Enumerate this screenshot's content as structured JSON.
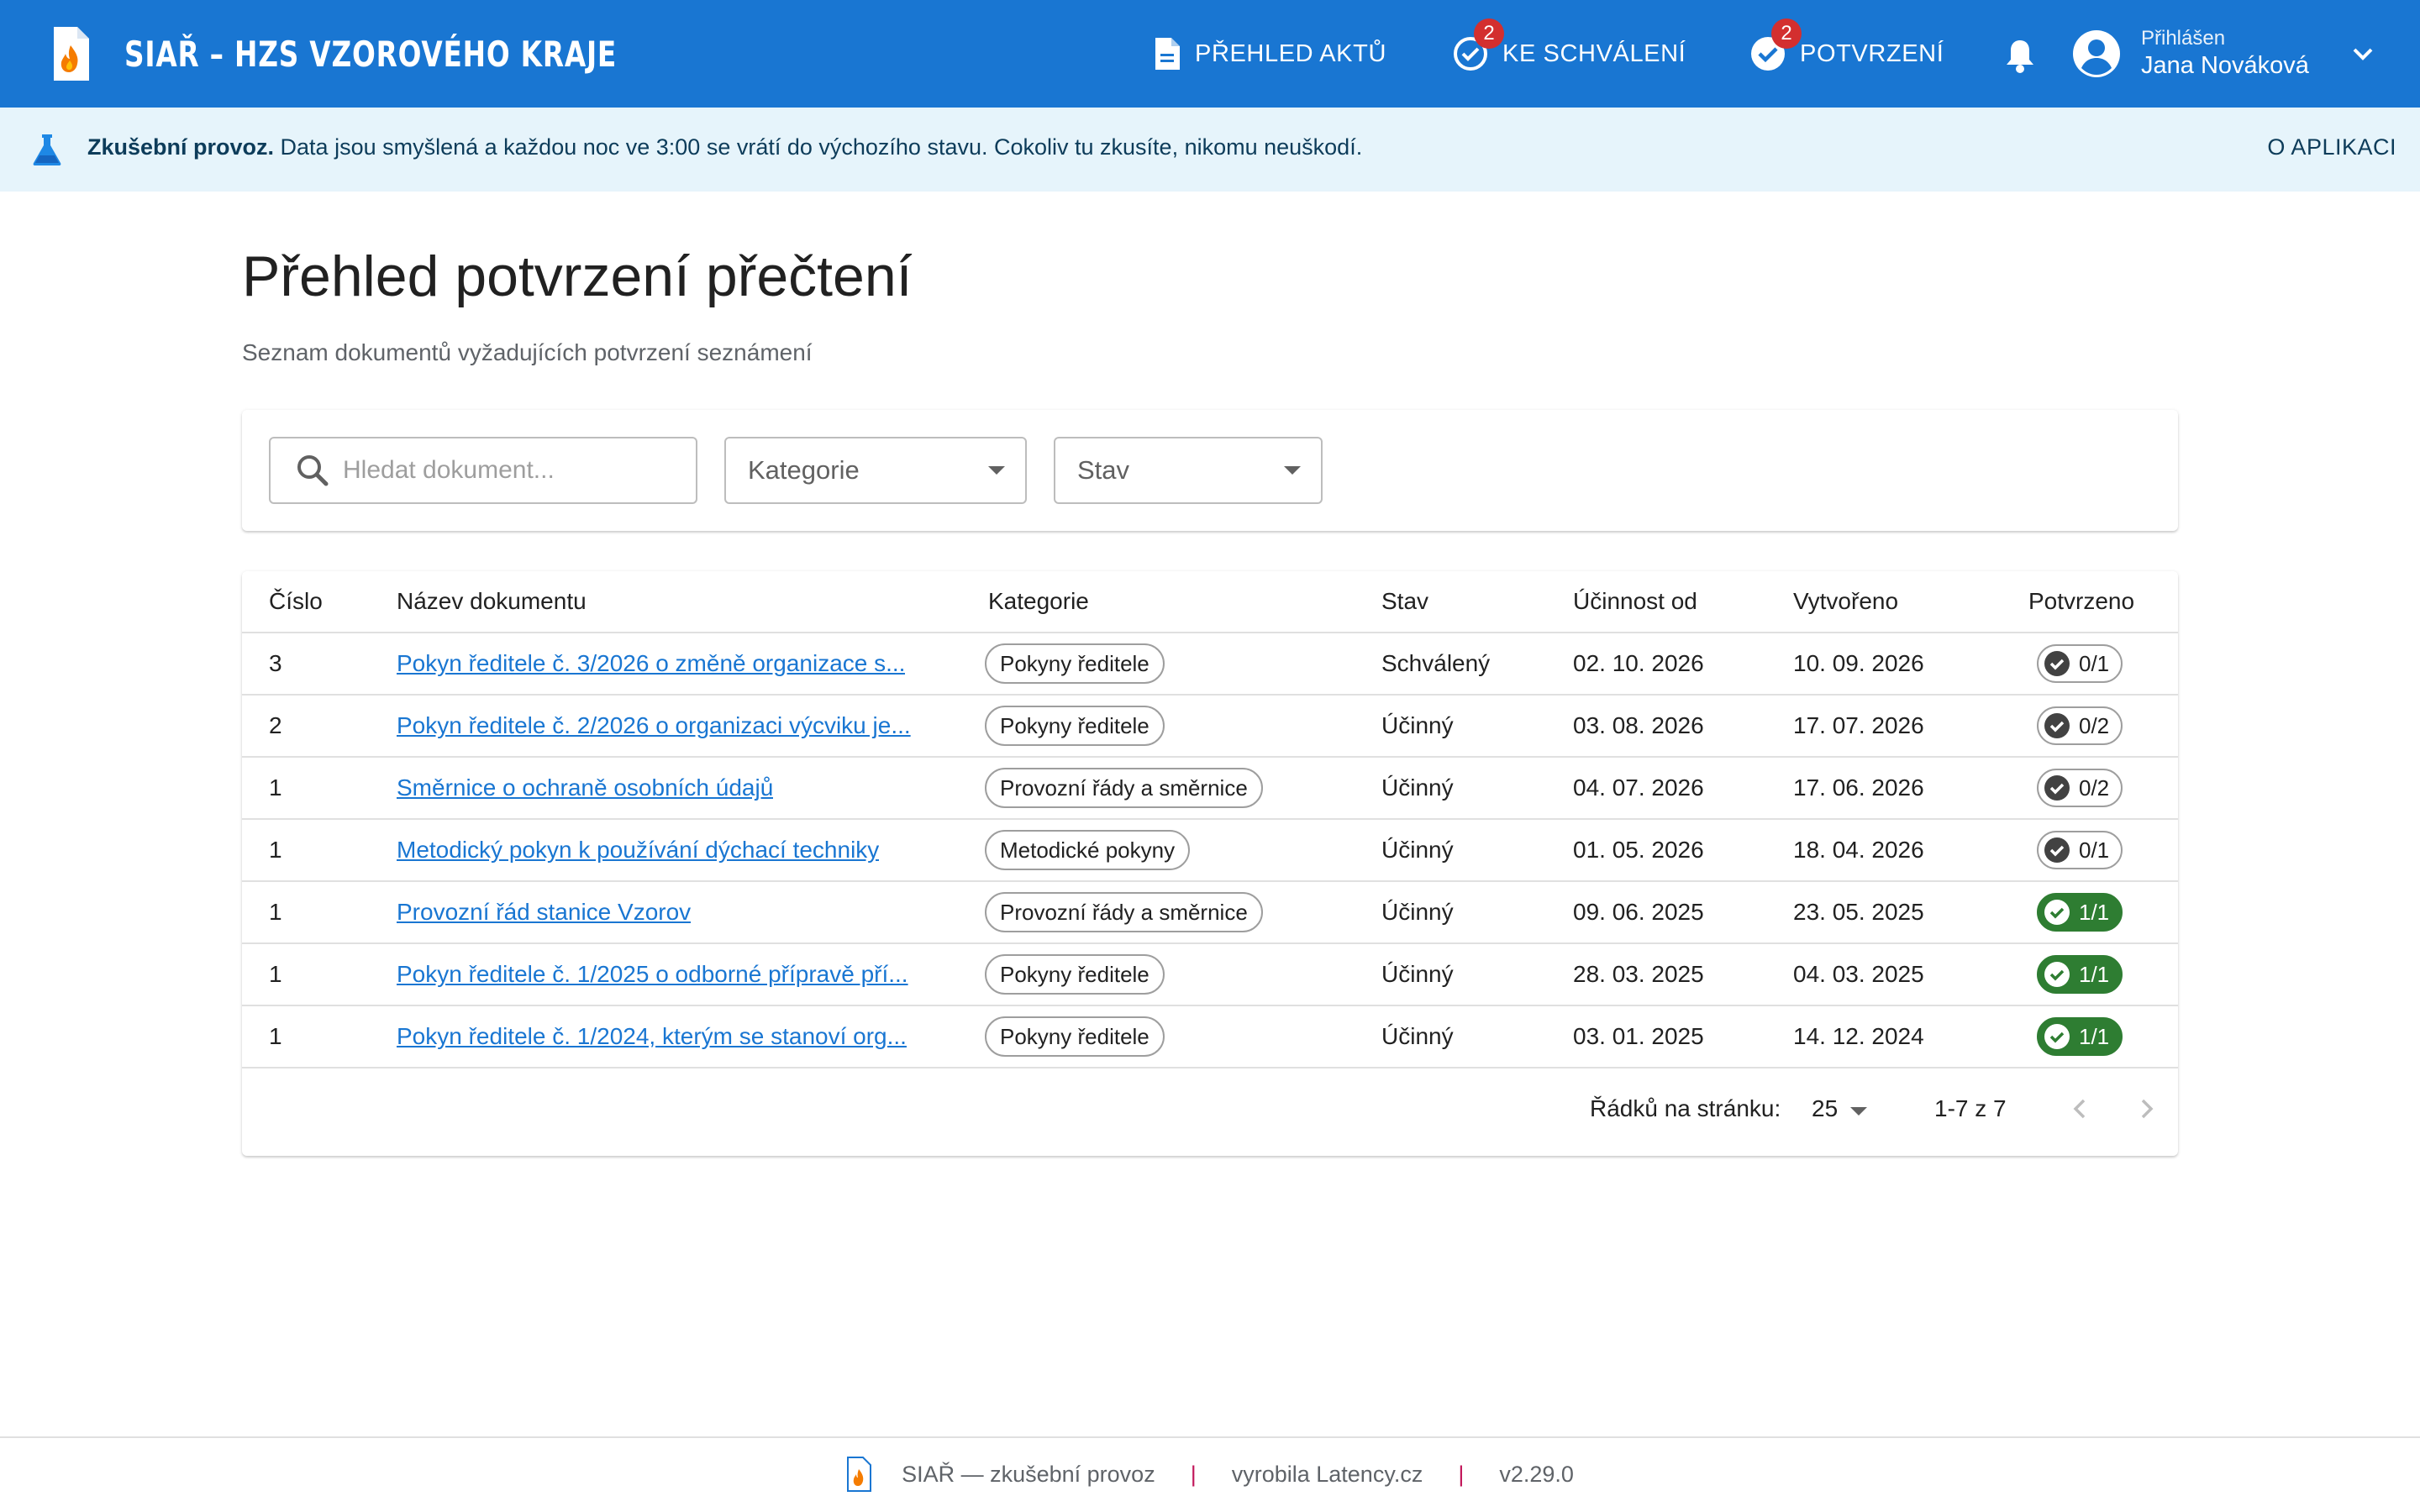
{
  "app": {
    "title": "SIAŘ – HZS VZOROVÉHO KRAJE",
    "accent_color": "#1976d2"
  },
  "nav": {
    "items": [
      {
        "label": "PŘEHLED AKTŮ",
        "icon": "document-icon",
        "badge": null
      },
      {
        "label": "KE SCHVÁLENÍ",
        "icon": "check-circle-outline-icon",
        "badge": "2"
      },
      {
        "label": "POTVRZENÍ",
        "icon": "check-circle-filled-icon",
        "badge": "2"
      }
    ],
    "notifications_icon": "bell-icon"
  },
  "user": {
    "caption": "Přihlášen",
    "name": "Jana Nováková",
    "avatar_icon": "account-circle-icon"
  },
  "banner": {
    "icon": "flask-icon",
    "bold": "Zkušební provoz.",
    "text": " Data jsou smyšlená a každou noc ve 3:00 se vrátí do výchozího stavu. Cokoliv tu zkusíte, nikomu neuškodí.",
    "link": "O APLIKACI",
    "background": "#e6f4fb"
  },
  "page": {
    "title": "Přehled potvrzení přečtení",
    "subtitle": "Seznam dokumentů vyžadujících potvrzení seznámení"
  },
  "filters": {
    "search_placeholder": "Hledat dokument...",
    "search_value": "",
    "category_label": "Kategorie",
    "state_label": "Stav"
  },
  "table": {
    "columns": [
      "Číslo",
      "Název dokumentu",
      "Kategorie",
      "Stav",
      "Účinnost od",
      "Vytvořeno",
      "Potvrzeno"
    ],
    "rows": [
      {
        "number": "3",
        "name": "Pokyn ředitele č. 3/2026 o změně organizace s...",
        "category": "Pokyny ředitele",
        "state": "Schválený",
        "effective": "02. 10. 2026",
        "created": "10. 09. 2026",
        "confirmed": "0/1",
        "done": false
      },
      {
        "number": "2",
        "name": "Pokyn ředitele č. 2/2026 o organizaci výcviku je...",
        "category": "Pokyny ředitele",
        "state": "Účinný",
        "effective": "03. 08. 2026",
        "created": "17. 07. 2026",
        "confirmed": "0/2",
        "done": false
      },
      {
        "number": "1",
        "name": "Směrnice o ochraně osobních údajů",
        "category": "Provozní řády a směrnice",
        "state": "Účinný",
        "effective": "04. 07. 2026",
        "created": "17. 06. 2026",
        "confirmed": "0/2",
        "done": false
      },
      {
        "number": "1",
        "name": "Metodický pokyn k používání dýchací techniky",
        "category": "Metodické pokyny",
        "state": "Účinný",
        "effective": "01. 05. 2026",
        "created": "18. 04. 2026",
        "confirmed": "0/1",
        "done": false
      },
      {
        "number": "1",
        "name": "Provozní řád stanice Vzorov",
        "category": "Provozní řády a směrnice",
        "state": "Účinný",
        "effective": "09. 06. 2025",
        "created": "23. 05. 2025",
        "confirmed": "1/1",
        "done": true
      },
      {
        "number": "1",
        "name": "Pokyn ředitele č. 1/2025 o odborné přípravě pří...",
        "category": "Pokyny ředitele",
        "state": "Účinný",
        "effective": "28. 03. 2025",
        "created": "04. 03. 2025",
        "confirmed": "1/1",
        "done": true
      },
      {
        "number": "1",
        "name": "Pokyn ředitele č. 1/2024, kterým se stanoví org...",
        "category": "Pokyny ředitele",
        "state": "Účinný",
        "effective": "03. 01. 2025",
        "created": "14. 12. 2024",
        "confirmed": "1/1",
        "done": true
      }
    ],
    "status_colors": {
      "done": "#2e7d32",
      "pending": "#9e9e9e",
      "link": "#1976d2"
    }
  },
  "pagination": {
    "rows_label": "Řádků na stránku:",
    "rows_value": "25",
    "range": "1-7 z 7"
  },
  "footer": {
    "product": "SIAŘ — zkušební provoz",
    "sep1": "|",
    "vendor": "vyrobila Latency.cz",
    "sep2": "|",
    "version": "v2.29.0"
  }
}
